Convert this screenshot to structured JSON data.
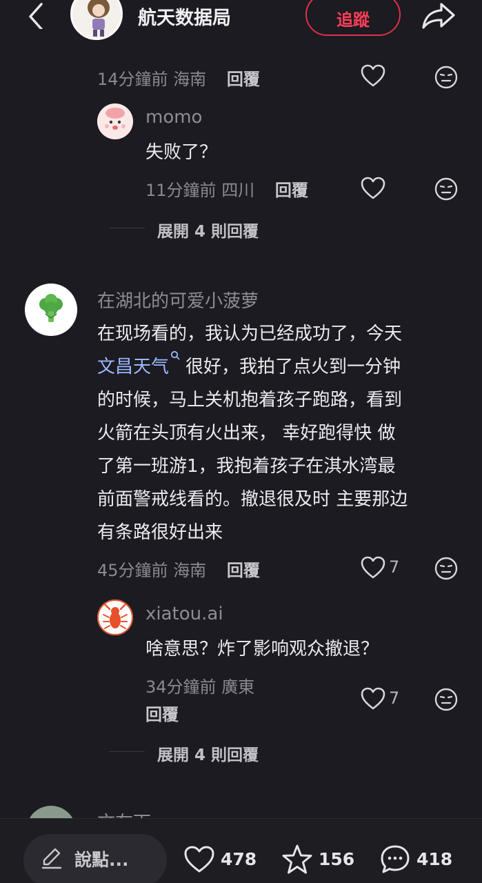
{
  "header": {
    "title": "航天数据局",
    "follow_label": "追蹤"
  },
  "comment0": {
    "time": "14分鐘前",
    "location": "海南",
    "reply": "回覆"
  },
  "reply1": {
    "username": "momo",
    "text": "失败了？",
    "time": "11分鐘前",
    "location": "四川",
    "reply": "回覆"
  },
  "expand1": "展開 4 則回覆",
  "comment2": {
    "username": "在湖北的可爱小菠萝",
    "lines": [
      "在现场看的，我认为已经成功了，今天",
      "很好，我拍了点火到一分钟",
      "的时候，马上关机抱着孩子跑路，看到",
      "火箭在头顶有火出来，  幸好跑得快 做",
      "了第一班游1，我抱着孩子在淇水湾最",
      "前面警戒线看的。撤退很及时 主要那边",
      "有条路很好出来"
    ],
    "link": "文昌天气",
    "time": "45分鐘前",
    "location": "海南",
    "reply": "回覆",
    "likes": "7"
  },
  "reply3": {
    "username": "xiatou.ai",
    "text": "啥意思？炸了影响观众撤退？",
    "time": "34分鐘前",
    "location": "廣東",
    "reply": "回覆",
    "likes": "7"
  },
  "expand2": "展開 4 則回覆",
  "partial_username": "文在下",
  "bottom": {
    "placeholder": "說點...",
    "likes": "478",
    "favorites": "156",
    "comments": "418"
  },
  "colors": {
    "background": "#1b1b21",
    "follow": "#ff3d58",
    "link": "#9bb8ff"
  }
}
